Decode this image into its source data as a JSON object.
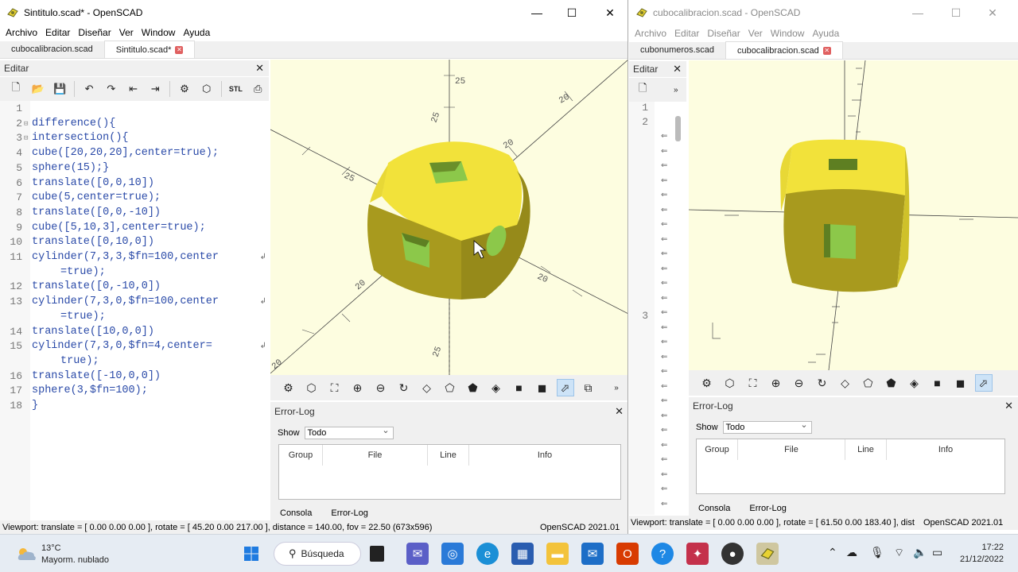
{
  "window_left": {
    "title": "Sintitulo.scad* - OpenSCAD",
    "menu": [
      "Archivo",
      "Editar",
      "Diseñar",
      "Ver",
      "Window",
      "Ayuda"
    ],
    "tabs": [
      "cubocalibracion.scad",
      "Sintitulo.scad*"
    ],
    "editor_header": "Editar",
    "code_lines": [
      {
        "n": "1",
        "text": ""
      },
      {
        "n": "2",
        "text": "difference(){"
      },
      {
        "n": "3",
        "text": "intersection(){"
      },
      {
        "n": "4",
        "text": "cube([20,20,20],center=true);"
      },
      {
        "n": "5",
        "text": "sphere(15);}"
      },
      {
        "n": "6",
        "text": "translate([0,0,10])"
      },
      {
        "n": "7",
        "text": "cube(5,center=true);"
      },
      {
        "n": "8",
        "text": "translate([0,0,-10])"
      },
      {
        "n": "9",
        "text": "cube([5,10,3],center=true);"
      },
      {
        "n": "10",
        "text": "translate([0,10,0])"
      },
      {
        "n": "11",
        "text": "cylinder(7,3,3,$fn=100,center",
        "cont": "=true);"
      },
      {
        "n": "12",
        "text": "translate([0,-10,0])"
      },
      {
        "n": "13",
        "text": "cylinder(7,3,0,$fn=100,center",
        "cont": "=true);"
      },
      {
        "n": "14",
        "text": "translate([10,0,0])"
      },
      {
        "n": "15",
        "text": "cylinder(7,3,0,$fn=4,center=",
        "cont": "true);"
      },
      {
        "n": "16",
        "text": "translate([-10,0,0])"
      },
      {
        "n": "17",
        "text": "sphere(3,$fn=100);"
      },
      {
        "n": "18",
        "text": "}"
      }
    ],
    "axis_labels": [
      "25",
      "20",
      "20",
      "25",
      "20",
      "20",
      "25",
      "20",
      "25"
    ],
    "errorlog": {
      "header": "Error-Log",
      "show_label": "Show",
      "show_value": "Todo",
      "columns": [
        "Group",
        "File",
        "Line",
        "Info"
      ]
    },
    "bottom_tabs": [
      "Consola",
      "Error-Log"
    ],
    "status": "Viewport: translate = [ 0.00 0.00 0.00 ], rotate = [ 45.20 0.00 217.00 ], distance = 140.00, fov = 22.50 (673x596)",
    "version": "OpenSCAD 2021.01"
  },
  "window_right": {
    "title": "cubocalibracion.scad - OpenSCAD",
    "menu": [
      "Archivo",
      "Editar",
      "Diseñar",
      "Ver",
      "Window",
      "Ayuda"
    ],
    "tabs": [
      "cubonumeros.scad",
      "cubocalibracion.scad"
    ],
    "editor_header": "Editar",
    "line_numbers": [
      "1",
      "2",
      "3"
    ],
    "errorlog": {
      "header": "Error-Log",
      "show_label": "Show",
      "show_value": "Todo",
      "columns": [
        "Group",
        "File",
        "Line",
        "Info"
      ]
    },
    "bottom_tabs": [
      "Consola",
      "Error-Log"
    ],
    "status": "Viewport: translate = [ 0.00 0.00 0.00 ], rotate = [ 61.50 0.00 183.40 ], dist",
    "version": "OpenSCAD 2021.01"
  },
  "taskbar": {
    "weather_temp": "13°C",
    "weather_desc": "Mayorm. nublado",
    "search_label": "Búsqueda",
    "time": "17:22",
    "date": "21/12/2022"
  },
  "colors": {
    "code_text": "#2a4aa8",
    "viewport_bg": "#fdfde0",
    "model_top": "#f2e23a",
    "model_side": "#a89a1e",
    "hole_green": "#8cc84a"
  }
}
